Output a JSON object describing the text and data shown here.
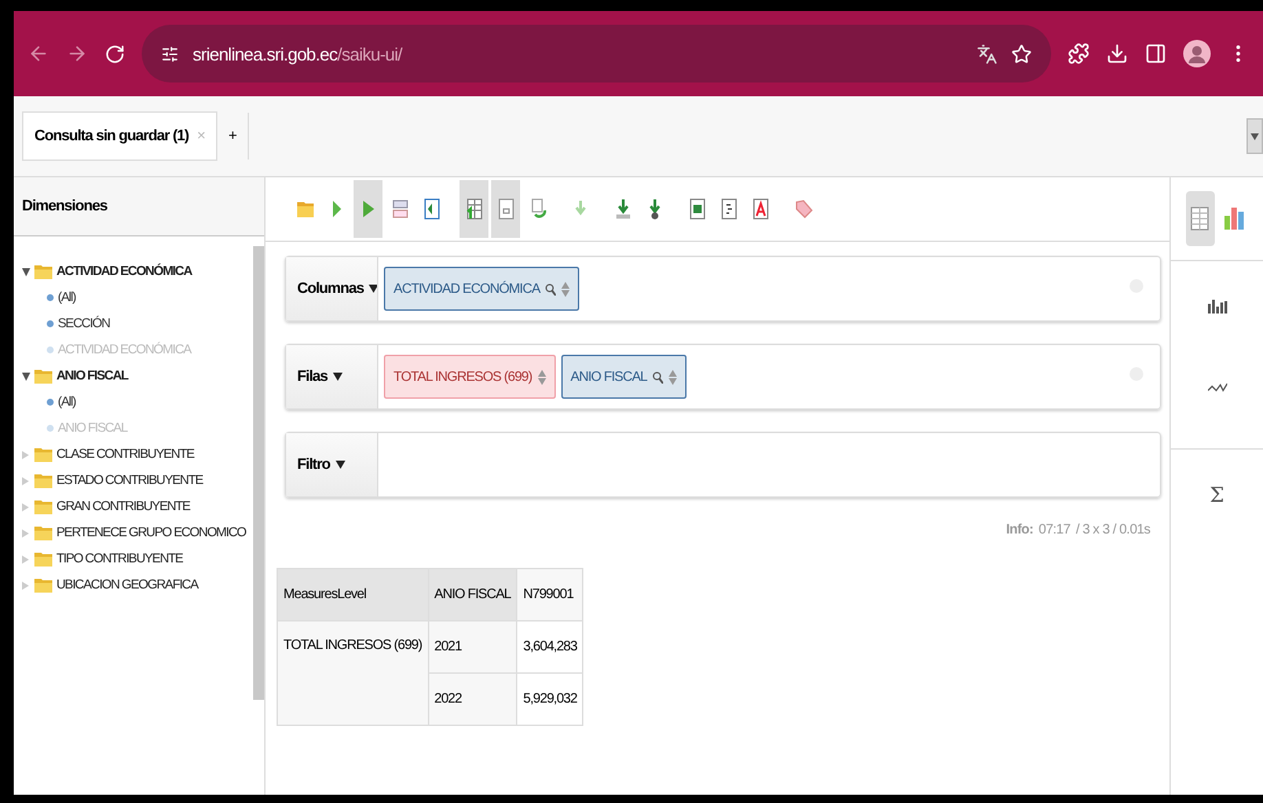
{
  "browser": {
    "url_host": "srienlinea.sri.gob.ec",
    "url_path": "/saiku-ui/"
  },
  "tabs": [
    {
      "label": "Consulta sin guardar (1)",
      "selected": true,
      "close": "×"
    }
  ],
  "new_tab": "+",
  "sidebar": {
    "title": "Dimensiones",
    "items": [
      {
        "label": "ACTIVIDAD ECONÓMICA",
        "expanded": true,
        "children": [
          {
            "label": "(All)",
            "disabled": false
          },
          {
            "label": "SECCIÓN",
            "disabled": false
          },
          {
            "label": "ACTIVIDAD ECONÓMICA",
            "disabled": true
          }
        ]
      },
      {
        "label": "ANIO FISCAL",
        "expanded": true,
        "children": [
          {
            "label": "(All)",
            "disabled": false
          },
          {
            "label": "ANIO FISCAL",
            "disabled": true
          }
        ]
      },
      {
        "label": "CLASE CONTRIBUYENTE",
        "expanded": false
      },
      {
        "label": "ESTADO CONTRIBUYENTE",
        "expanded": false
      },
      {
        "label": "GRAN CONTRIBUYENTE",
        "expanded": false
      },
      {
        "label": "PERTENECE GRUPO ECONOMICO",
        "expanded": false
      },
      {
        "label": "TIPO CONTRIBUYENTE",
        "expanded": false
      },
      {
        "label": "UBICACION GEOGRAFICA",
        "expanded": false
      }
    ]
  },
  "toolbar": [
    {
      "kind": "open",
      "pressed": false
    },
    {
      "kind": "run",
      "pressed": false
    },
    {
      "kind": "auto-run",
      "pressed": true
    },
    {
      "kind": "fields",
      "pressed": false
    },
    {
      "kind": "layout",
      "pressed": false
    },
    {
      "kind": "table",
      "pressed": true
    },
    {
      "kind": "empty",
      "pressed": true
    },
    {
      "kind": "swap",
      "pressed": false
    },
    {
      "kind": "drill",
      "pressed": false
    },
    {
      "kind": "drill-down",
      "pressed": false
    },
    {
      "kind": "drill-across",
      "pressed": false
    },
    {
      "kind": "excel",
      "pressed": false
    },
    {
      "kind": "csv",
      "pressed": false
    },
    {
      "kind": "pdf",
      "pressed": false
    },
    {
      "kind": "tag",
      "pressed": false
    }
  ],
  "axes": [
    {
      "label": "Columnas",
      "items": [
        {
          "label": "ACTIVIDAD ECONÓMICA",
          "kind": "dimension"
        }
      ]
    },
    {
      "label": "Filas",
      "items": [
        {
          "label": "TOTAL INGRESOS (699)",
          "kind": "measure"
        },
        {
          "label": "ANIO FISCAL",
          "kind": "dimension"
        }
      ]
    },
    {
      "label": "Filtro"
    }
  ],
  "info": {
    "label": "Info:",
    "time": "07:17",
    "stats": "/ 3 x 3 / 0.01s"
  },
  "table": {
    "columns": [
      "MeasuresLevel",
      "ANIO FISCAL",
      "N799001"
    ],
    "measure": "TOTAL INGRESOS (699)",
    "rows": [
      {
        "year": "2021",
        "value": "3,604,283"
      },
      {
        "year": "2022",
        "value": "5,929,032"
      }
    ]
  },
  "right_panel": {
    "views": [
      {
        "kind": "table",
        "selected": true
      },
      {
        "kind": "chart",
        "selected": false
      }
    ],
    "sum": "Σ"
  }
}
